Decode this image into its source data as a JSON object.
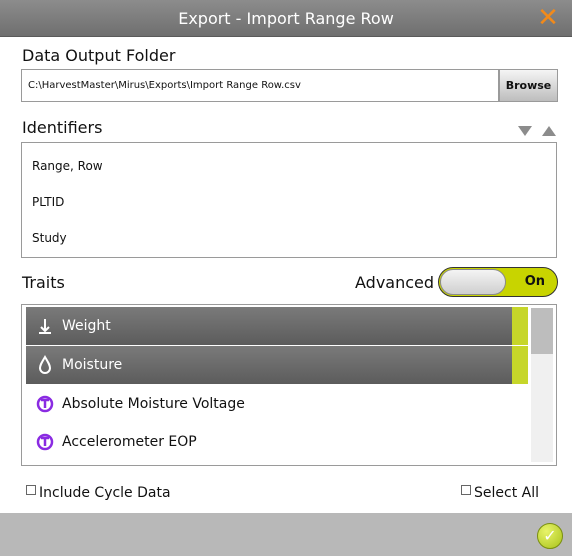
{
  "titlebar": {
    "title": "Export - Import Range Row",
    "close_glyph": "✕"
  },
  "output": {
    "label": "Data Output Folder",
    "path": "C:\\HarvestMaster\\Mirus\\Exports\\Import Range Row.csv",
    "browse_label": "Browse"
  },
  "identifiers": {
    "label": "Identifiers",
    "items": [
      "Range, Row",
      "PLTID",
      "Study"
    ]
  },
  "traits": {
    "label": "Traits",
    "advanced_label": "Advanced",
    "toggle_state": "On",
    "items": [
      {
        "label": "Weight",
        "icon": "weight-icon",
        "selected": true
      },
      {
        "label": "Moisture",
        "icon": "moisture-drop-icon",
        "selected": true
      },
      {
        "label": "Absolute Moisture Voltage",
        "icon": "calculated-trait-icon",
        "selected": false
      },
      {
        "label": "Accelerometer EOP",
        "icon": "calculated-trait-icon",
        "selected": false
      }
    ],
    "accent_color": "#c6d62a",
    "icon_color": "#8a2be2"
  },
  "options": {
    "include_cycle_label": "Include Cycle Data",
    "include_cycle_checked": false,
    "select_all_label": "Select All",
    "select_all_checked": false
  },
  "footer": {
    "ok_icon": "check-circle-icon"
  }
}
